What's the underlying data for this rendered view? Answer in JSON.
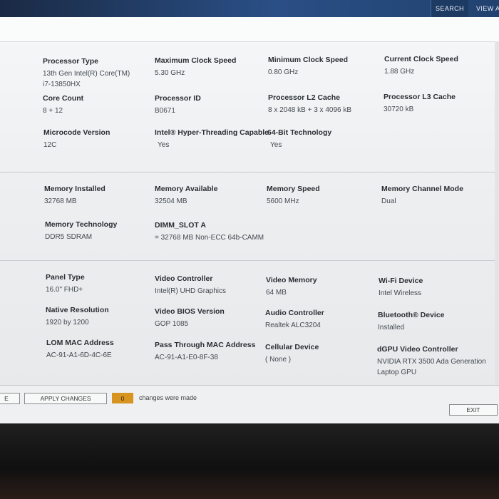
{
  "header": {
    "search_label": "SEARCH",
    "view_label": "VIEW A"
  },
  "processor": {
    "type_label": "Processor Type",
    "type_value": "13th Gen Intel(R) Core(TM)\ni7-13850HX",
    "max_clock_label": "Maximum Clock Speed",
    "max_clock_value": "5.30 GHz",
    "min_clock_label": "Minimum Clock Speed",
    "min_clock_value": "0.80 GHz",
    "cur_clock_label": "Current Clock Speed",
    "cur_clock_value": "1.88 GHz",
    "core_count_label": "Core Count",
    "core_count_value": "8 + 12",
    "id_label": "Processor ID",
    "id_value": "B0671",
    "l2_label": "Processor L2 Cache",
    "l2_value": "8 x 2048  kB + 3 x 4096  kB",
    "l3_label": "Processor L3 Cache",
    "l3_value": "30720 kB",
    "microcode_label": "Microcode Version",
    "microcode_value": "12C",
    "ht_label": "Intel® Hyper-Threading Capable",
    "ht_value": "Yes",
    "x64_label": "64-Bit Technology",
    "x64_value": "Yes"
  },
  "memory": {
    "installed_label": "Memory Installed",
    "installed_value": "32768 MB",
    "available_label": "Memory Available",
    "available_value": "32504 MB",
    "speed_label": "Memory Speed",
    "speed_value": "5600 MHz",
    "channel_label": "Memory Channel Mode",
    "channel_value": "Dual",
    "tech_label": "Memory Technology",
    "tech_value": "DDR5 SDRAM",
    "slot_label": "DIMM_SLOT A",
    "slot_value": "= 32768 MB Non-ECC 64b-CAMM"
  },
  "devices": {
    "panel_label": "Panel Type",
    "panel_value": "16.0\" FHD+",
    "video_ctrl_label": "Video Controller",
    "video_ctrl_value": "Intel(R) UHD Graphics",
    "video_mem_label": "Video Memory",
    "video_mem_value": "64 MB",
    "wifi_label": "Wi-Fi Device",
    "wifi_value": "Intel Wireless",
    "native_res_label": "Native Resolution",
    "native_res_value": "1920 by 1200",
    "vbios_label": "Video BIOS Version",
    "vbios_value": "GOP 1085",
    "audio_label": "Audio Controller",
    "audio_value": "Realtek ALC3204",
    "bt_label": "Bluetooth® Device",
    "bt_value": "Installed",
    "lom_label": "LOM MAC Address",
    "lom_value": "AC-91-A1-6D-4C-6E",
    "pass_mac_label": "Pass Through MAC Address",
    "pass_mac_value": "AC-91-A1-E0-8F-38",
    "cell_label": "Cellular Device",
    "cell_value": "( None )",
    "dgpu_label": "dGPU Video Controller",
    "dgpu_value": "NVIDIA RTX 3500 Ada Generation\nLaptop GPU"
  },
  "footer": {
    "left_button": "E",
    "apply_label": "APPLY CHANGES",
    "changes_count": "0",
    "changes_text": "changes were made",
    "exit_label": "EXIT"
  },
  "colors": {
    "accent_counter": "#d89420",
    "topbar": "#2a4f86"
  }
}
